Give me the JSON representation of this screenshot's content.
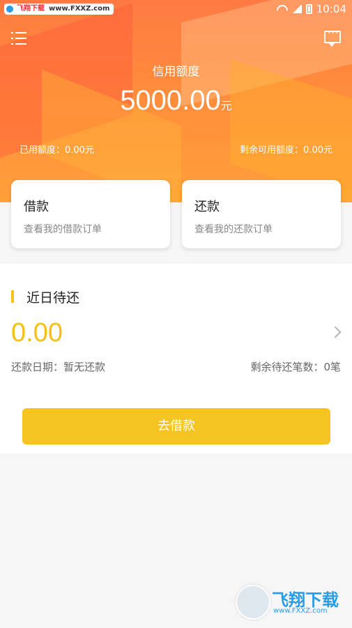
{
  "status_bar": {
    "watermark_text": "飞翔下载",
    "watermark_url": "www.FXXZ.com",
    "time": "10:04"
  },
  "header": {
    "credit_label": "信用额度",
    "credit_amount": "5000.00",
    "credit_unit": "元",
    "used_label": "已用额度：0.00元",
    "remaining_label": "剩余可用额度：0.00元"
  },
  "cards": {
    "borrow": {
      "title": "借款",
      "desc": "查看我的借款订单"
    },
    "repay": {
      "title": "还款",
      "desc": "查看我的还款订单"
    }
  },
  "recent_due": {
    "title": "近日待还",
    "amount": "0.00",
    "date_label": "还款日期：暂无还款",
    "count_label": "剩余待还笔数：0笔"
  },
  "cta": {
    "label": "去借款"
  },
  "brand": {
    "name": "飞翔下载",
    "site": "www.FXXZ.com"
  },
  "colors": {
    "accent": "#f6c420",
    "header": "#ff8a3c"
  }
}
